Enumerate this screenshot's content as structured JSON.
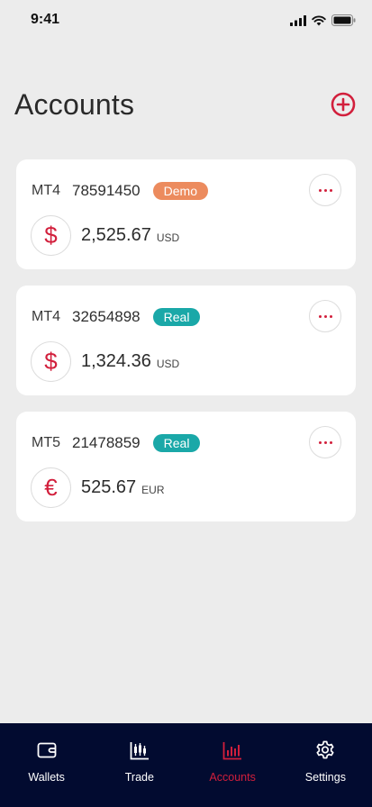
{
  "status_bar": {
    "time": "9:41"
  },
  "header": {
    "title": "Accounts",
    "add_icon": "plus-circle-icon"
  },
  "accounts": [
    {
      "platform": "MT4",
      "number": "78591450",
      "type": "Demo",
      "type_color": "#ec8b5e",
      "currency_symbol": "$",
      "balance": "2,525.67",
      "currency": "USD"
    },
    {
      "platform": "MT4",
      "number": "32654898",
      "type": "Real",
      "type_color": "#1aa8a8",
      "currency_symbol": "$",
      "balance": "1,324.36",
      "currency": "USD"
    },
    {
      "platform": "MT5",
      "number": "21478859",
      "type": "Real",
      "type_color": "#1aa8a8",
      "currency_symbol": "€",
      "balance": "525.67",
      "currency": "EUR"
    }
  ],
  "tabbar": {
    "items": [
      {
        "label": "Wallets",
        "icon": "wallet-icon",
        "active": false
      },
      {
        "label": "Trade",
        "icon": "candlestick-icon",
        "active": false
      },
      {
        "label": "Accounts",
        "icon": "bar-chart-icon",
        "active": true
      },
      {
        "label": "Settings",
        "icon": "gear-icon",
        "active": false
      }
    ]
  },
  "colors": {
    "accent": "#d21f3c",
    "tabbar_bg": "#020b30",
    "background": "#ececec"
  }
}
